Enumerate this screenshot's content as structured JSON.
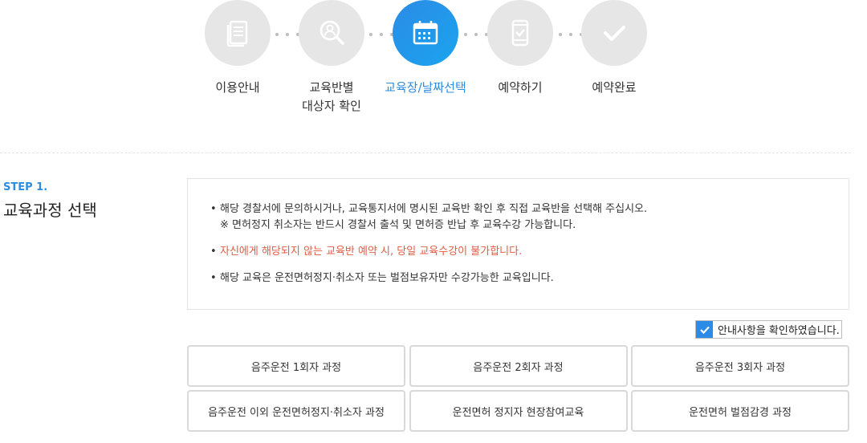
{
  "steps": [
    {
      "label": "이용안내",
      "icon": "document-icon",
      "active": false
    },
    {
      "label": "교육반별",
      "label2": "대상자 확인",
      "icon": "search-person-icon",
      "active": false
    },
    {
      "label": "교육장/날짜선택",
      "icon": "calendar-icon",
      "active": true
    },
    {
      "label": "예약하기",
      "icon": "mobile-check-icon",
      "active": false
    },
    {
      "label": "예약완료",
      "icon": "checkmark-icon",
      "active": false
    }
  ],
  "section": {
    "step_tag": "STEP 1.",
    "title": "교육과정 선택"
  },
  "notice": {
    "line1": "해당 경찰서에 문의하시거나, 교육통지서에 명시된 교육반 확인 후 직접 교육반을 선택해 주십시오.",
    "line1_sub": "※ 면허정지 취소자는 반드시 경찰서 출석 및 면허증 반납 후 교육수강 가능합니다.",
    "line2": "자신에게 해당되지 않는 교육반 예약 시, 당일 교육수강이 불가합니다.",
    "line3": "해당 교육은 운전면허정지·취소자 또는 벌점보유자만 수강가능한 교육입니다."
  },
  "confirm": {
    "label": "안내사항을 확인하였습니다.",
    "checked": true
  },
  "courses": [
    "음주운전 1회자 과정",
    "음주운전 2회자 과정",
    "음주운전 3회자 과정",
    "음주운전 이외 운전면허정지·취소자 과정",
    "운전면허 정지자 현장참여교육",
    "운전면허 벌점감경 과정"
  ],
  "colors": {
    "accent": "#2b8be6",
    "warning": "#e55a43",
    "inactive_circle": "#e6e6e6"
  }
}
